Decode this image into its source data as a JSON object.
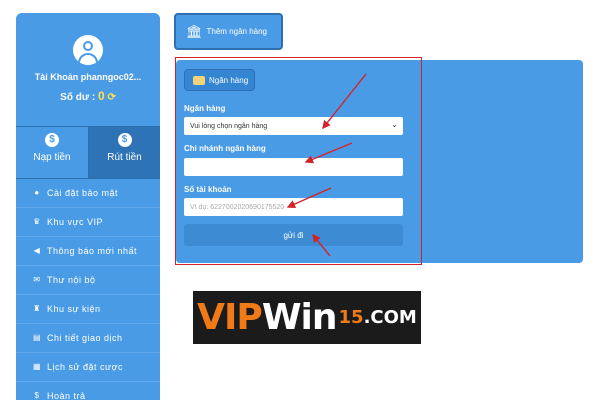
{
  "colors": {
    "primary": "#4a9be6",
    "dark_blue": "#2d73b5",
    "highlight": "#d3232a",
    "balance": "#ffe14a",
    "logo_orange": "#f07a17"
  },
  "sidebar": {
    "account": "Tài Khoản phanngoc02...",
    "balance_label": "Số dư :",
    "balance_value": "0",
    "refresh_icon": "refresh-icon",
    "actions": [
      {
        "label": "Nạp tiền",
        "icon": "deposit-icon"
      },
      {
        "label": "Rút tiền",
        "icon": "withdraw-icon"
      }
    ],
    "menu": [
      {
        "label": "Cài đặt bảo mật",
        "icon": "user-lock-icon"
      },
      {
        "label": "Khu vực VIP",
        "icon": "crown-icon"
      },
      {
        "label": "Thông báo mới nhất",
        "icon": "megaphone-icon"
      },
      {
        "label": "Thư nội bộ",
        "icon": "mail-icon"
      },
      {
        "label": "Khu sự kiện",
        "icon": "trophy-icon"
      },
      {
        "label": "Chi tiết giao dịch",
        "icon": "clipboard-icon"
      },
      {
        "label": "Lịch sử đặt cược",
        "icon": "history-icon"
      },
      {
        "label": "Hoàn trả",
        "icon": "refund-icon"
      }
    ]
  },
  "tab": {
    "label": "Thêm ngân hàng",
    "icon": "bank-icon"
  },
  "form": {
    "chip_label": "Ngân hàng",
    "bank_label": "Ngân hàng",
    "bank_select_value": "Vui lòng chọn ngân hàng",
    "branch_label": "Chi nhánh ngân hàng",
    "branch_value": "",
    "account_label": "Số tài khoản",
    "account_placeholder": "Ví dụ: 6227002020690175520",
    "submit_label": "gửi đi"
  },
  "logo": {
    "part1": "VIP",
    "part2": "Win",
    "part3": "15",
    "part4": ".COM"
  }
}
